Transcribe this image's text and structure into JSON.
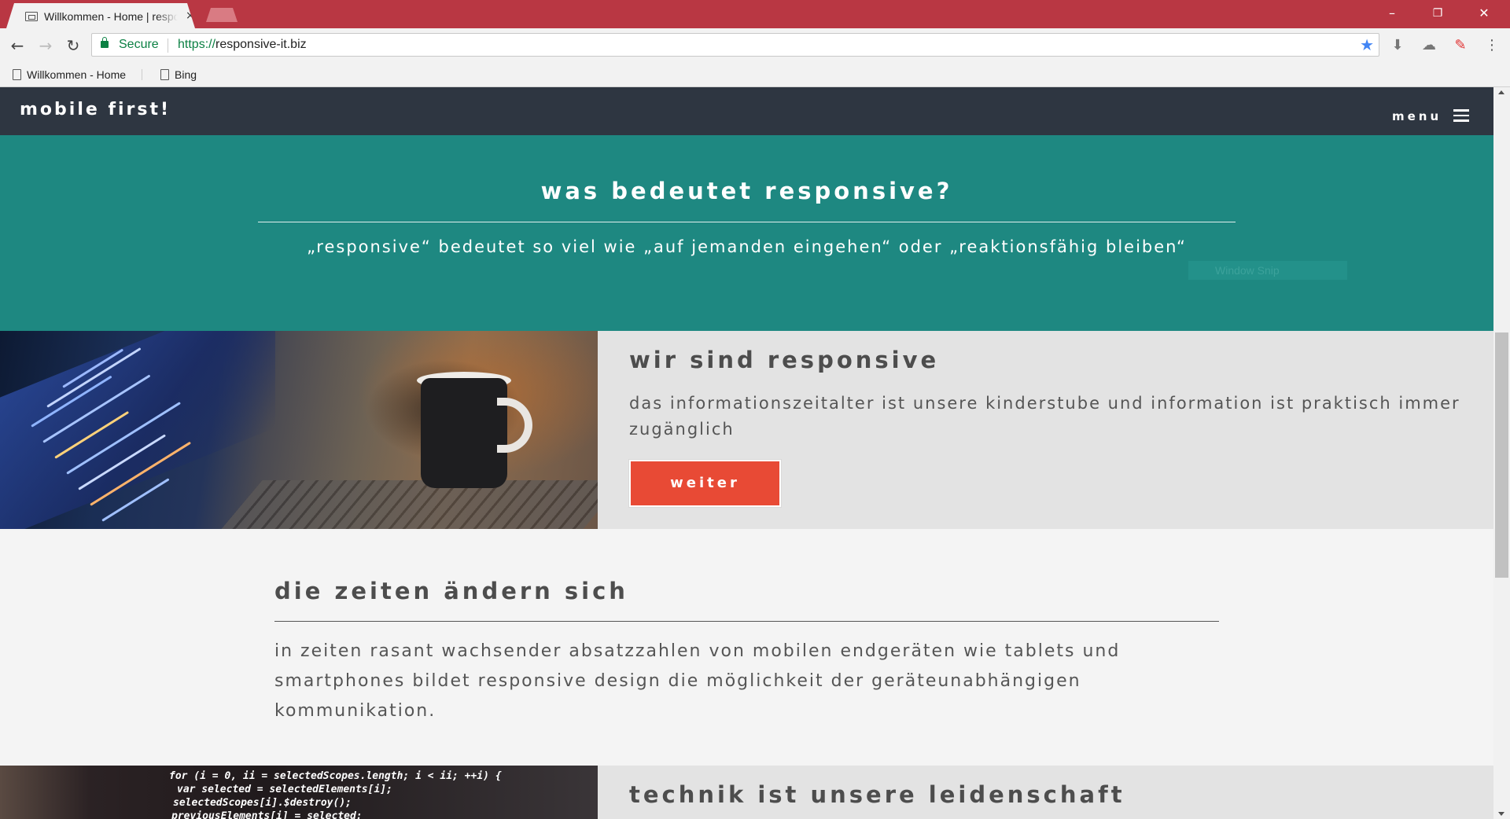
{
  "browser": {
    "tab_title": "Willkommen - Home | responsive-it.biz",
    "tab_close": "×",
    "window_controls": {
      "minimize": "–",
      "restore": "❐",
      "close": "✕"
    },
    "nav": {
      "back": "←",
      "forward": "→",
      "reload": "↻"
    },
    "security_label": "Secure",
    "url_scheme": "https://",
    "url_host": "responsive-it.biz",
    "bookmark_star": "★",
    "extensions": {
      "download": "⬇",
      "cloud": "☁",
      "stamp": "✎",
      "more": "⋮"
    },
    "bookmarks": [
      {
        "label": "Willkommen - Home"
      },
      {
        "label": "Bing"
      }
    ],
    "snip_tooltip": "Window Snip"
  },
  "header": {
    "brand": "mobile first!",
    "menu_label": "menu"
  },
  "hero": {
    "title": "was bedeutet responsive?",
    "quote": "„responsive“ bedeutet so viel wie „auf jemanden eingehen“ oder „reaktionsfähig bleiben“"
  },
  "feature_responsive": {
    "title": "wir sind responsive",
    "text": "das informationszeitalter ist unsere kinderstube und information ist praktisch immer zugänglich",
    "button_label": "weiter"
  },
  "section_times": {
    "title": "die zeiten ändern sich",
    "text": "in zeiten rasant wachsender absatzzahlen von mobilen endgeräten wie tablets und smartphones bildet responsive design die möglichkeit der geräteunabhängigen kommunikation."
  },
  "feature_tech": {
    "title": "technik ist unsere leidenschaft",
    "code_lines": [
      "for (i = 0, ii = selectedScopes.length; i < ii; ++i) {",
      "var selected = selectedElements[i];",
      "selectedScopes[i].$destroy();",
      "previousElements[i] = selected;"
    ]
  }
}
